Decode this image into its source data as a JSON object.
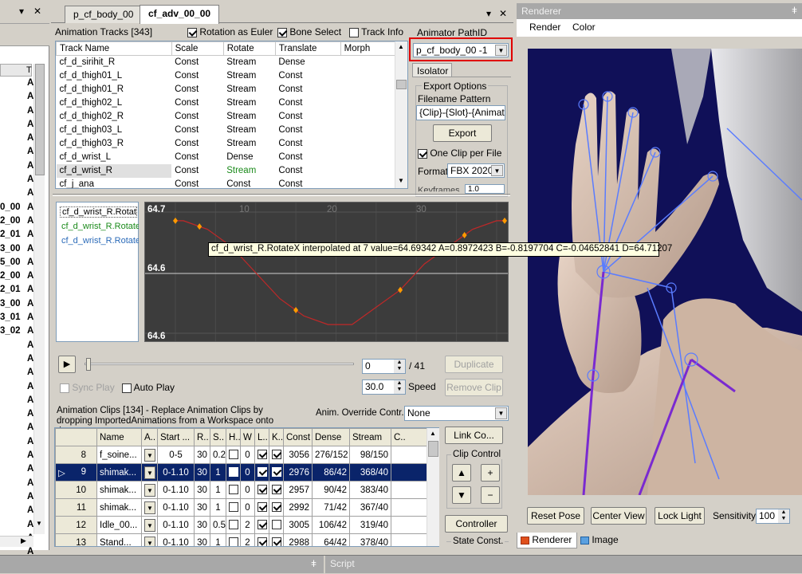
{
  "left_panel": {
    "pin": "▾",
    "close": "✕",
    "col_t": "T",
    "rows": [
      "A",
      "A",
      "A",
      "A",
      "A",
      "A",
      "A",
      "A",
      "A",
      "A",
      "A",
      "A",
      "A",
      "A",
      "A",
      "A",
      "A",
      "A",
      "A",
      "A",
      "A",
      "A",
      "A",
      "A",
      "A",
      "A",
      "A",
      "A",
      "A",
      "A",
      "A",
      "A",
      "A",
      "A",
      "A"
    ],
    "partial_names": [
      "0_00",
      "2_00",
      "2_01",
      "3_00",
      "5_00",
      "2_00",
      "2_01",
      "3_00",
      "3_01",
      "3_02"
    ]
  },
  "tabs": [
    {
      "label": "p_cf_body_00"
    },
    {
      "label": "cf_adv_00_00"
    }
  ],
  "window_controls": {
    "dropdown": "▾",
    "close": "✕"
  },
  "tracks": {
    "header": "Animation Tracks [343]",
    "opt_euler": "Rotation as Euler",
    "opt_bone": "Bone Select",
    "opt_info": "Track Info",
    "columns": [
      "Track Name",
      "Scale",
      "Rotate",
      "Translate",
      "Morph"
    ],
    "rows": [
      [
        "cf_d_sirihit_R",
        "Const",
        "Stream",
        "Dense"
      ],
      [
        "cf_d_thigh01_L",
        "Const",
        "Stream",
        "Const"
      ],
      [
        "cf_d_thigh01_R",
        "Const",
        "Stream",
        "Const"
      ],
      [
        "cf_d_thigh02_L",
        "Const",
        "Stream",
        "Const"
      ],
      [
        "cf_d_thigh02_R",
        "Const",
        "Stream",
        "Const"
      ],
      [
        "cf_d_thigh03_L",
        "Const",
        "Stream",
        "Const"
      ],
      [
        "cf_d_thigh03_R",
        "Const",
        "Stream",
        "Const"
      ],
      [
        "cf_d_wrist_L",
        "Const",
        "Dense",
        "Const"
      ],
      [
        "cf_d_wrist_R",
        "Const",
        "Stream",
        "Const"
      ],
      [
        "cf_j_ana",
        "Const",
        "Const",
        "Const"
      ]
    ]
  },
  "animator": {
    "label": "Animator PathID",
    "value": "p_cf_body_00 -1",
    "isolator_tab": "Isolator"
  },
  "export": {
    "group": "Export Options",
    "pattern_label": "Filename Pattern",
    "pattern_value": "{Clip}-{Slot}-{Animator}",
    "export_btn": "Export",
    "one_clip": "One Clip per File",
    "format_label": "Format",
    "format_value": "FBX 2020.",
    "keyframes_label": "Keyframes",
    "keyframes_value": "1.0"
  },
  "curves": {
    "items": [
      "cf_d_wrist_R.RotateX",
      "cf_d_wrist_R.RotateY",
      "cf_d_wrist_R.RotateZ"
    ],
    "y_top": "64.7",
    "y_mid": "64.6",
    "y_bot": "64.6",
    "x_ticks": [
      "10",
      "20",
      "30"
    ],
    "tooltip": "cf_d_wrist_R.RotateX interpolated at 7 value=64.69342 A=0.8972423 B=-0.8197704 C=-0.04652841 D=64.71207"
  },
  "chart_data": {
    "type": "line",
    "title": "",
    "xlabel": "",
    "ylabel": "",
    "series": [
      {
        "name": "cf_d_wrist_R.RotateX",
        "x": [
          0,
          1,
          4,
          7,
          10,
          13,
          16,
          19,
          22,
          25,
          28,
          31,
          34,
          37,
          40,
          41
        ],
        "y": [
          64.7,
          64.7,
          64.69,
          64.67,
          64.64,
          64.61,
          64.59,
          64.58,
          64.58,
          64.6,
          64.62,
          64.65,
          64.67,
          64.69,
          64.7,
          64.7
        ]
      }
    ],
    "keyframes_x": [
      0,
      3,
      15,
      28,
      36,
      41
    ],
    "xlim": [
      0,
      41
    ],
    "ylim": [
      64.57,
      64.71
    ]
  },
  "playback": {
    "frame": "0",
    "total": "/ 41",
    "speed": "30.0",
    "speed_label": "Speed",
    "sync_play": "Sync Play",
    "auto_play": "Auto Play",
    "duplicate": "Duplicate",
    "remove": "Remove Clip",
    "play": "▶"
  },
  "clips": {
    "info": "Animation Clips [134] - Replace Animation Clips by dropping ImportedAnimations from a Workspace onto them.",
    "override_label": "Anim. Override Contr.",
    "override_value": "None",
    "columns": [
      "",
      "Name",
      "A..",
      "Start ...",
      "R..",
      "S..",
      "H..",
      "W",
      "L..",
      "K..",
      "Const",
      "Dense",
      "Stream",
      "C.."
    ],
    "rows": [
      {
        "idx": "8",
        "name": "f_soine...",
        "start": "0-5",
        "r": "30",
        "s": "0.2",
        "h": false,
        "w": "0",
        "l": true,
        "k": true,
        "const": "3056",
        "dense": "276/152",
        "stream": "98/150",
        "sel": false
      },
      {
        "idx": "9",
        "name": "shimak...",
        "start": "0-1.10",
        "r": "30",
        "s": "1",
        "h": false,
        "w": "0",
        "l": true,
        "k": true,
        "const": "2976",
        "dense": "86/42",
        "stream": "368/40",
        "sel": true
      },
      {
        "idx": "10",
        "name": "shimak...",
        "start": "0-1.10",
        "r": "30",
        "s": "1",
        "h": false,
        "w": "0",
        "l": true,
        "k": true,
        "const": "2957",
        "dense": "90/42",
        "stream": "383/40",
        "sel": false
      },
      {
        "idx": "11",
        "name": "shimak...",
        "start": "0-1.10",
        "r": "30",
        "s": "1",
        "h": false,
        "w": "0",
        "l": true,
        "k": true,
        "const": "2992",
        "dense": "71/42",
        "stream": "367/40",
        "sel": false
      },
      {
        "idx": "12",
        "name": "Idle_00...",
        "start": "0-1.10",
        "r": "30",
        "s": "0.5",
        "h": false,
        "w": "2",
        "l": true,
        "k": false,
        "const": "3005",
        "dense": "106/42",
        "stream": "319/40",
        "sel": false
      },
      {
        "idx": "13",
        "name": "Stand...",
        "start": "0-1.10",
        "r": "30",
        "s": "1",
        "h": false,
        "w": "2",
        "l": true,
        "k": true,
        "const": "2988",
        "dense": "64/42",
        "stream": "378/40",
        "sel": false
      }
    ],
    "link_btn": "Link Co...",
    "clip_control": "Clip Control",
    "controller_btn": "Controller",
    "state_const": "State Const."
  },
  "renderer": {
    "title": "Renderer",
    "menu": [
      "Render",
      "Color"
    ],
    "reset_pose": "Reset Pose",
    "center_view": "Center View",
    "lock_light": "Lock Light",
    "sensitivity_label": "Sensitivity",
    "sensitivity_value": "100",
    "tabs": [
      "Renderer",
      "Image"
    ]
  },
  "bottom": {
    "script": "Script",
    "pin": "ǂ"
  },
  "colors": {
    "viewport_bg": "#101058",
    "selected_row": "#0a246a",
    "highlight_border": "#e00000",
    "curve": "#c02828",
    "key_point": "#ff9900"
  }
}
